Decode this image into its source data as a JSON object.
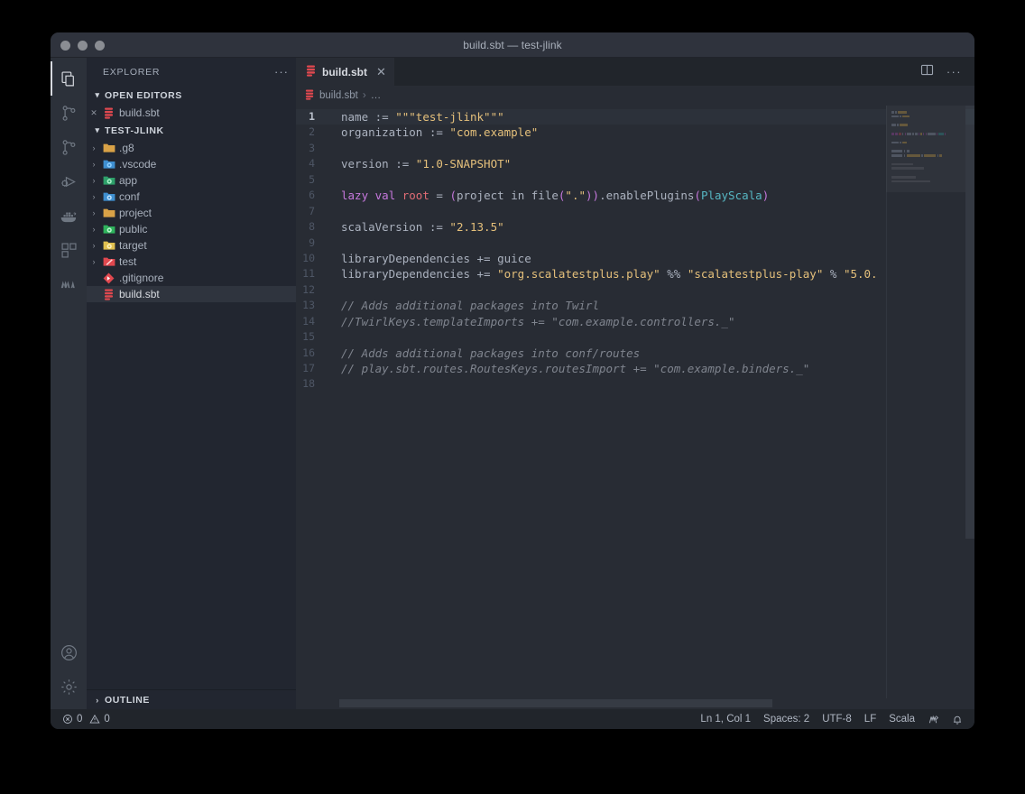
{
  "window": {
    "title": "build.sbt — test-jlink",
    "traffic_lights": [
      "close",
      "minimize",
      "zoom"
    ]
  },
  "activity_bar": {
    "items": [
      {
        "name": "explorer",
        "icon": "files-icon",
        "active": true
      },
      {
        "name": "source-control",
        "icon": "source-control-icon",
        "active": false
      },
      {
        "name": "source-control-alt",
        "icon": "source-control-icon",
        "active": false
      },
      {
        "name": "run-and-debug",
        "icon": "run-debug-icon",
        "active": false
      },
      {
        "name": "docker",
        "icon": "docker-icon",
        "active": false
      },
      {
        "name": "extensions",
        "icon": "extensions-icon",
        "active": false
      },
      {
        "name": "metals",
        "icon": "metals-icon",
        "active": false
      }
    ],
    "bottom_items": [
      {
        "name": "accounts",
        "icon": "account-icon"
      },
      {
        "name": "manage",
        "icon": "gear-icon"
      }
    ]
  },
  "sidebar": {
    "title": "EXPLORER",
    "more_actions": "···",
    "open_editors": {
      "label": "OPEN EDITORS",
      "expanded": true,
      "chevron": "▾",
      "items": [
        {
          "label": "build.sbt",
          "icon": "sbt-file-icon",
          "close": "✕"
        }
      ]
    },
    "project": {
      "label": "TEST-JLINK",
      "expanded": true,
      "chevron": "▾",
      "items": [
        {
          "label": ".g8",
          "type": "folder",
          "icon": "folder-icon",
          "color": "#d9a247",
          "arrow": "›",
          "selected": false
        },
        {
          "label": ".vscode",
          "type": "folder",
          "icon": "vscode-folder-icon",
          "color": "#3f8fd0",
          "arrow": "›",
          "selected": false
        },
        {
          "label": "app",
          "type": "folder",
          "icon": "app-folder-icon",
          "color": "#2ea06a",
          "arrow": "›",
          "selected": false
        },
        {
          "label": "conf",
          "type": "folder",
          "icon": "config-folder-icon",
          "color": "#3f8fd0",
          "arrow": "›",
          "selected": false
        },
        {
          "label": "project",
          "type": "folder",
          "icon": "folder-icon",
          "color": "#d9a247",
          "arrow": "›",
          "selected": false
        },
        {
          "label": "public",
          "type": "folder",
          "icon": "public-folder-icon",
          "color": "#2fb35c",
          "arrow": "›",
          "selected": false
        },
        {
          "label": "target",
          "type": "folder",
          "icon": "target-folder-icon",
          "color": "#e0c050",
          "arrow": "›",
          "selected": false
        },
        {
          "label": "test",
          "type": "folder",
          "icon": "test-folder-icon",
          "color": "#e0484f",
          "arrow": "›",
          "selected": false
        },
        {
          "label": ".gitignore",
          "type": "file",
          "icon": "git-icon",
          "color": "#e0484f",
          "arrow": "",
          "selected": false
        },
        {
          "label": "build.sbt",
          "type": "file",
          "icon": "sbt-file-icon",
          "color": "#e0484f",
          "arrow": "",
          "selected": true
        }
      ]
    },
    "outline": {
      "label": "OUTLINE",
      "expanded": false,
      "chevron": "›"
    }
  },
  "editor": {
    "tabs": [
      {
        "label": "build.sbt",
        "icon": "sbt-file-icon",
        "close": "✕",
        "active": true
      }
    ],
    "actions": [
      {
        "name": "split-editor",
        "icon": "split-editor-icon"
      },
      {
        "name": "more-actions",
        "icon": "ellipsis-icon",
        "glyph": "···"
      }
    ],
    "breadcrumb": {
      "file": "build.sbt",
      "separator": "›",
      "rest": "…",
      "icon": "sbt-file-icon"
    },
    "cursor_line": 1,
    "lines": [
      {
        "n": 1,
        "tokens": [
          {
            "t": "name ",
            "c": "txt"
          },
          {
            "t": ":= ",
            "c": "op"
          },
          {
            "t": "\"\"\"test-jlink\"\"\"",
            "c": "str"
          }
        ]
      },
      {
        "n": 2,
        "tokens": [
          {
            "t": "organization ",
            "c": "txt"
          },
          {
            "t": ":= ",
            "c": "op"
          },
          {
            "t": "\"com.example\"",
            "c": "str"
          }
        ]
      },
      {
        "n": 3,
        "tokens": []
      },
      {
        "n": 4,
        "tokens": [
          {
            "t": "version ",
            "c": "txt"
          },
          {
            "t": ":= ",
            "c": "op"
          },
          {
            "t": "\"1.0-SNAPSHOT\"",
            "c": "str"
          }
        ]
      },
      {
        "n": 5,
        "tokens": []
      },
      {
        "n": 6,
        "tokens": [
          {
            "t": "lazy ",
            "c": "kw"
          },
          {
            "t": "val ",
            "c": "kw"
          },
          {
            "t": "root ",
            "c": "var"
          },
          {
            "t": "= ",
            "c": "op"
          },
          {
            "t": "(",
            "c": "par"
          },
          {
            "t": "project ",
            "c": "txt"
          },
          {
            "t": "in ",
            "c": "txt"
          },
          {
            "t": "file",
            "c": "txt"
          },
          {
            "t": "(",
            "c": "par"
          },
          {
            "t": "\".\"",
            "c": "str"
          },
          {
            "t": ")",
            "c": "par"
          },
          {
            "t": ")",
            "c": "par"
          },
          {
            "t": ".enablePlugins",
            "c": "txt"
          },
          {
            "t": "(",
            "c": "par"
          },
          {
            "t": "PlayScala",
            "c": "cls"
          },
          {
            "t": ")",
            "c": "par"
          }
        ]
      },
      {
        "n": 7,
        "tokens": []
      },
      {
        "n": 8,
        "tokens": [
          {
            "t": "scalaVersion ",
            "c": "txt"
          },
          {
            "t": ":= ",
            "c": "op"
          },
          {
            "t": "\"2.13.5\"",
            "c": "str"
          }
        ]
      },
      {
        "n": 9,
        "tokens": []
      },
      {
        "n": 10,
        "tokens": [
          {
            "t": "libraryDependencies ",
            "c": "txt"
          },
          {
            "t": "+= ",
            "c": "op"
          },
          {
            "t": "guice",
            "c": "txt"
          }
        ]
      },
      {
        "n": 11,
        "tokens": [
          {
            "t": "libraryDependencies ",
            "c": "txt"
          },
          {
            "t": "+= ",
            "c": "op"
          },
          {
            "t": "\"org.scalatestplus.play\" ",
            "c": "str"
          },
          {
            "t": "%% ",
            "c": "op"
          },
          {
            "t": "\"scalatestplus-play\" ",
            "c": "str"
          },
          {
            "t": "% ",
            "c": "op"
          },
          {
            "t": "\"5.0.",
            "c": "str"
          }
        ]
      },
      {
        "n": 12,
        "tokens": []
      },
      {
        "n": 13,
        "tokens": [
          {
            "t": "// Adds additional packages into Twirl",
            "c": "cmt"
          }
        ]
      },
      {
        "n": 14,
        "tokens": [
          {
            "t": "//TwirlKeys.templateImports += \"com.example.controllers._\"",
            "c": "cmt"
          }
        ]
      },
      {
        "n": 15,
        "tokens": []
      },
      {
        "n": 16,
        "tokens": [
          {
            "t": "// Adds additional packages into conf/routes",
            "c": "cmt"
          }
        ]
      },
      {
        "n": 17,
        "tokens": [
          {
            "t": "// play.sbt.routes.RoutesKeys.routesImport += \"com.example.binders._\"",
            "c": "cmt"
          }
        ]
      },
      {
        "n": 18,
        "tokens": []
      }
    ]
  },
  "status_bar": {
    "left": [
      {
        "name": "problems",
        "icon": "error-icon",
        "errors": "0",
        "warn_icon": "warning-icon",
        "warnings": "0"
      }
    ],
    "right": [
      {
        "name": "line-col",
        "label": "Ln 1, Col 1"
      },
      {
        "name": "indent",
        "label": "Spaces: 2"
      },
      {
        "name": "encoding",
        "label": "UTF-8"
      },
      {
        "name": "eol",
        "label": "LF"
      },
      {
        "name": "language",
        "label": "Scala"
      },
      {
        "name": "metals",
        "label": "",
        "icon": "metals-status-icon"
      },
      {
        "name": "notifications",
        "label": "",
        "icon": "bell-icon"
      }
    ]
  },
  "colors": {
    "editor_bg": "#282c34",
    "sidebar_bg": "#222630",
    "activity_bg": "#2c313a",
    "titlebar_bg": "#2f333d",
    "statusbar_bg": "#21252b",
    "accent_red": "#e0484f",
    "string": "#e5c07b",
    "keyword": "#c678dd",
    "comment": "#7f848e",
    "class": "#56b6c2"
  }
}
